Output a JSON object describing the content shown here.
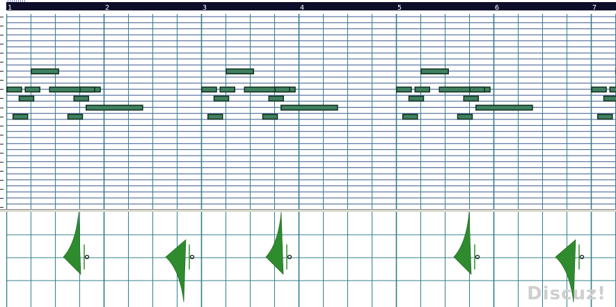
{
  "ruler": {
    "bar_numbers": [
      "1",
      "2",
      "3",
      "4",
      "5",
      "6",
      "7"
    ]
  },
  "piano_roll": {
    "notes": [
      {
        "bar": 1,
        "beat": 0,
        "len": 0.15,
        "row": 8
      },
      {
        "bar": 1,
        "beat": 0.25,
        "len": 0.15,
        "row": 11
      },
      {
        "bar": 1,
        "beat": 0.5,
        "len": 0.15,
        "row": 9
      },
      {
        "bar": 1,
        "beat": 0.75,
        "len": 0.15,
        "row": 8
      },
      {
        "bar": 1,
        "beat": 1,
        "len": 0.28,
        "row": 6
      },
      {
        "bar": 1,
        "beat": 1.75,
        "len": 0.52,
        "row": 8
      },
      {
        "bar": 1,
        "beat": 2.5,
        "len": 0.15,
        "row": 11
      },
      {
        "bar": 1,
        "beat": 2.75,
        "len": 0.15,
        "row": 9
      },
      {
        "bar": 1,
        "beat": 3,
        "len": 0.15,
        "row": 8
      },
      {
        "bar": 1,
        "beat": 3.25,
        "len": 0.58,
        "row": 10
      }
    ],
    "repeat_bars": [
      1,
      3,
      5,
      7
    ]
  },
  "velocity_lane": {
    "hits": [
      {
        "beat": 1.5,
        "dir": "up"
      },
      {
        "beat": 3.5,
        "dir": "down"
      },
      {
        "beat": 5.5,
        "dir": "up"
      },
      {
        "beat": 9.5,
        "dir": "up"
      },
      {
        "beat": 11.5,
        "dir": "down"
      }
    ]
  },
  "colors": {
    "background": "#ffffff",
    "grid_line": "#2f7f8a",
    "row_line": "#38558c",
    "note_fill": "#3f7f5f",
    "note_border": "#0f2f1f",
    "waveform": "#2e8b2e",
    "ruler_bar": "#0e0e2a"
  },
  "watermark": "Discuz!"
}
